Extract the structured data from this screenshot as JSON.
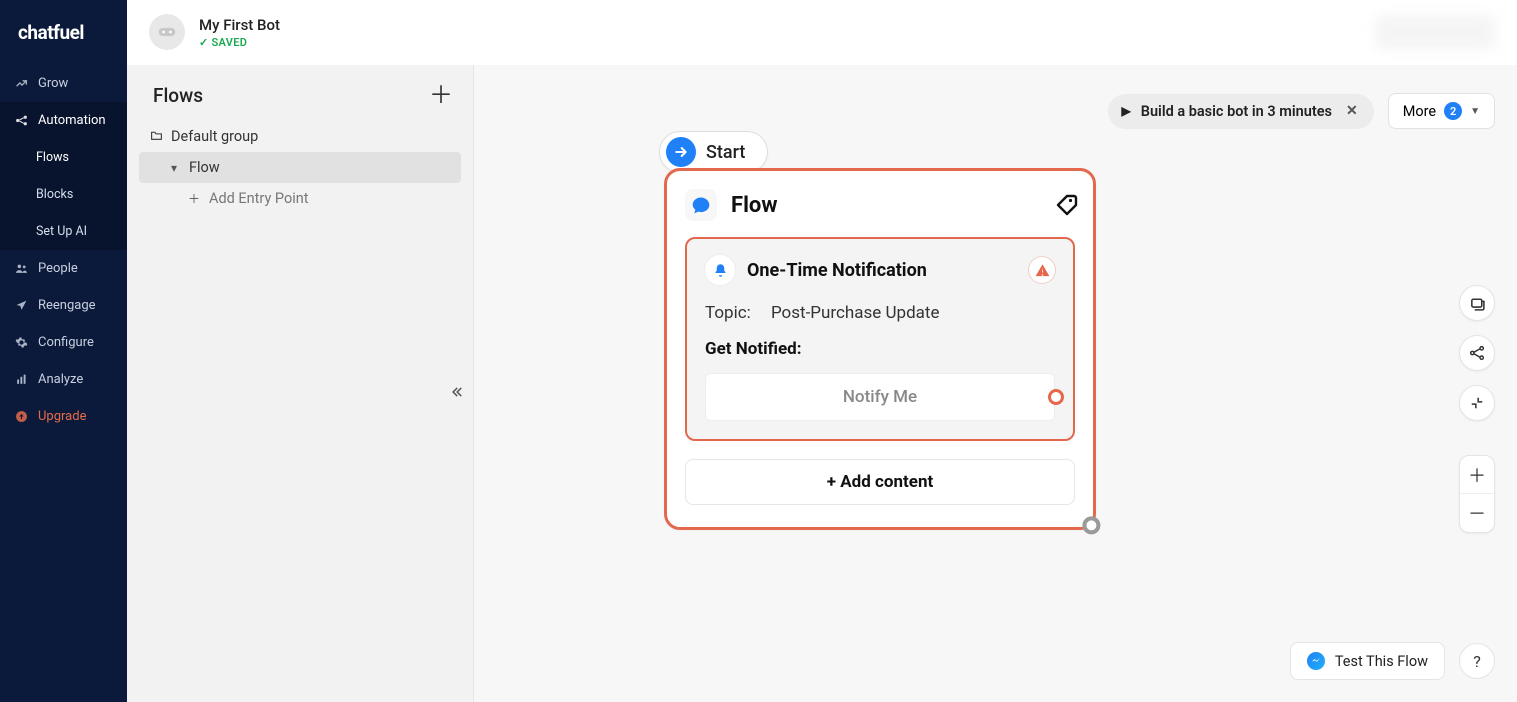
{
  "brand": "chatfuel",
  "header": {
    "bot_title": "My First Bot",
    "saved_label": "SAVED"
  },
  "sidebar": {
    "items": [
      {
        "id": "grow",
        "label": "Grow"
      },
      {
        "id": "automation",
        "label": "Automation"
      },
      {
        "id": "people",
        "label": "People"
      },
      {
        "id": "reengage",
        "label": "Reengage"
      },
      {
        "id": "configure",
        "label": "Configure"
      },
      {
        "id": "analyze",
        "label": "Analyze"
      },
      {
        "id": "upgrade",
        "label": "Upgrade"
      }
    ],
    "automation_sub": [
      {
        "id": "flows",
        "label": "Flows"
      },
      {
        "id": "blocks",
        "label": "Blocks"
      },
      {
        "id": "setupai",
        "label": "Set Up AI"
      }
    ]
  },
  "flows_panel": {
    "title": "Flows",
    "group_label": "Default group",
    "flow_label": "Flow",
    "add_entry_label": "Add Entry Point"
  },
  "canvas": {
    "tip_label": "Build a basic bot in 3 minutes",
    "more_label": "More",
    "more_count": "2",
    "start_label": "Start"
  },
  "flow_card": {
    "title": "Flow",
    "block": {
      "title": "One-Time Notification",
      "topic_label": "Topic:",
      "topic_value": "Post-Purchase Update",
      "get_notified_label": "Get Notified:",
      "notify_button": "Notify Me"
    },
    "add_content_label": "+ Add content"
  },
  "bottom": {
    "test_flow_label": "Test This Flow",
    "help_label": "?"
  }
}
